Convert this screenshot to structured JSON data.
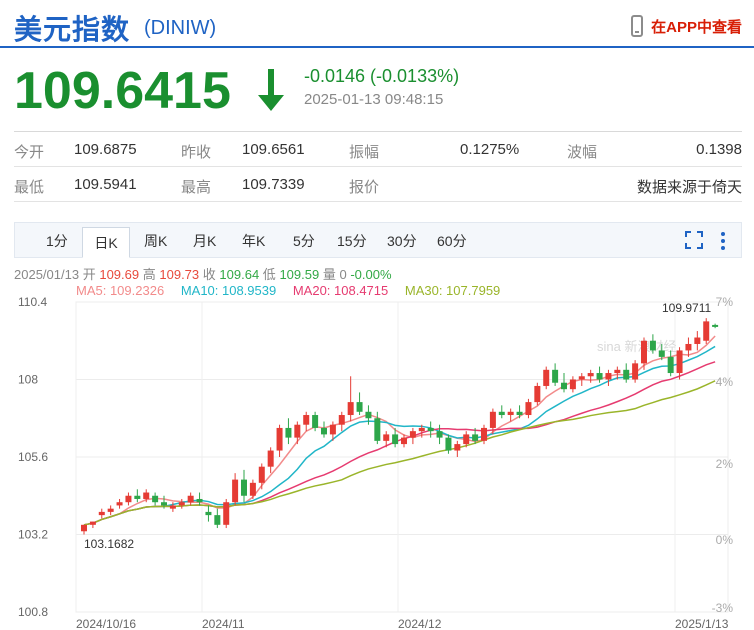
{
  "header": {
    "title": "美元指数",
    "code": "(DINIW)",
    "app_label": "在APP中查看"
  },
  "price": {
    "value": "109.6415",
    "change": "-0.0146 (-0.0133%)",
    "time": "2025-01-13 09:48:15"
  },
  "quote": {
    "row1": [
      [
        "今开",
        "109.6875"
      ],
      [
        "昨收",
        "109.6561"
      ],
      [
        "振幅",
        "0.1275%"
      ],
      [
        "波幅",
        "0.1398"
      ]
    ],
    "row2": [
      [
        "最低",
        "109.5941"
      ],
      [
        "最高",
        "109.7339"
      ],
      [
        "报价",
        ""
      ],
      [
        "",
        "数据来源于倚天"
      ]
    ]
  },
  "tabs": [
    "1分",
    "日K",
    "周K",
    "月K",
    "年K",
    "5分",
    "15分",
    "30分",
    "60分"
  ],
  "ohlc": {
    "date": "2025/01/13",
    "open_label": "开",
    "open": "109.69",
    "high_label": "高",
    "high": "109.73",
    "close_label": "收",
    "close": "109.64",
    "low_label": "低",
    "low": "109.59",
    "volume_label": "量",
    "volume": "0",
    "change": "-0.00%"
  },
  "ma": [
    {
      "label": "MA5: 109.2326",
      "color": "#f28b8b"
    },
    {
      "label": "MA10: 108.9539",
      "color": "#21b6c8"
    },
    {
      "label": "MA20: 108.4715",
      "color": "#e63b70"
    },
    {
      "label": "MA30: 107.7959",
      "color": "#9ab52a"
    }
  ],
  "chart_data": {
    "type": "candlestick",
    "x_ticks": [
      "2024/10/16",
      "2024/11",
      "2024/12",
      "2025/1/13"
    ],
    "y_ticks": [
      "110.4",
      "108",
      "105.6",
      "103.2",
      "100.8"
    ],
    "right_ticks": [
      "7%",
      "4%",
      "2%",
      "0%",
      "-3%"
    ],
    "annotations": {
      "max_label": "109.9711",
      "min_label": "103.1682"
    },
    "watermark": "sina 新浪财经",
    "candles": [
      [
        103.3,
        103.5,
        103.2,
        103.5
      ],
      [
        103.5,
        103.6,
        103.4,
        103.6
      ],
      [
        103.8,
        104.0,
        103.7,
        103.9
      ],
      [
        103.9,
        104.1,
        103.8,
        104.0
      ],
      [
        104.1,
        104.3,
        104.0,
        104.2
      ],
      [
        104.2,
        104.5,
        104.1,
        104.4
      ],
      [
        104.4,
        104.6,
        104.2,
        104.3
      ],
      [
        104.3,
        104.6,
        104.2,
        104.5
      ],
      [
        104.4,
        104.5,
        104.1,
        104.2
      ],
      [
        104.2,
        104.4,
        104.0,
        104.1
      ],
      [
        104.0,
        104.2,
        103.9,
        104.1
      ],
      [
        104.1,
        104.3,
        104.0,
        104.2
      ],
      [
        104.2,
        104.5,
        104.1,
        104.4
      ],
      [
        104.3,
        104.5,
        104.1,
        104.2
      ],
      [
        103.9,
        104.1,
        103.6,
        103.8
      ],
      [
        103.8,
        104.0,
        103.4,
        103.5
      ],
      [
        103.5,
        104.3,
        103.4,
        104.2
      ],
      [
        104.2,
        105.1,
        104.1,
        104.9
      ],
      [
        104.9,
        105.2,
        104.2,
        104.4
      ],
      [
        104.4,
        104.9,
        104.3,
        104.8
      ],
      [
        104.8,
        105.4,
        104.6,
        105.3
      ],
      [
        105.3,
        105.9,
        105.1,
        105.8
      ],
      [
        105.8,
        106.6,
        105.6,
        106.5
      ],
      [
        106.5,
        106.8,
        106.0,
        106.2
      ],
      [
        106.2,
        106.7,
        106.0,
        106.6
      ],
      [
        106.6,
        107.0,
        106.4,
        106.9
      ],
      [
        106.9,
        107.0,
        106.4,
        106.5
      ],
      [
        106.5,
        106.7,
        106.2,
        106.3
      ],
      [
        106.3,
        106.7,
        106.1,
        106.6
      ],
      [
        106.6,
        107.0,
        106.4,
        106.9
      ],
      [
        106.9,
        108.1,
        106.7,
        107.3
      ],
      [
        107.3,
        107.6,
        106.9,
        107.0
      ],
      [
        107.0,
        107.2,
        106.6,
        106.8
      ],
      [
        106.8,
        107.0,
        106.0,
        106.1
      ],
      [
        106.1,
        106.4,
        105.9,
        106.3
      ],
      [
        106.3,
        106.5,
        105.9,
        106.0
      ],
      [
        106.0,
        106.3,
        105.9,
        106.2
      ],
      [
        106.2,
        106.5,
        106.0,
        106.4
      ],
      [
        106.4,
        106.6,
        106.2,
        106.5
      ],
      [
        106.5,
        106.7,
        106.2,
        106.4
      ],
      [
        106.4,
        106.6,
        106.0,
        106.2
      ],
      [
        106.2,
        106.3,
        105.7,
        105.8
      ],
      [
        105.8,
        106.1,
        105.6,
        106.0
      ],
      [
        106.0,
        106.4,
        105.9,
        106.3
      ],
      [
        106.3,
        106.5,
        106.0,
        106.1
      ],
      [
        106.1,
        106.6,
        106.0,
        106.5
      ],
      [
        106.5,
        107.1,
        106.3,
        107.0
      ],
      [
        107.0,
        107.2,
        106.8,
        106.9
      ],
      [
        106.9,
        107.1,
        106.7,
        107.0
      ],
      [
        107.0,
        107.2,
        106.8,
        106.9
      ],
      [
        106.9,
        107.4,
        106.8,
        107.3
      ],
      [
        107.3,
        107.9,
        107.2,
        107.8
      ],
      [
        107.8,
        108.4,
        107.7,
        108.3
      ],
      [
        108.3,
        108.5,
        107.8,
        107.9
      ],
      [
        107.9,
        108.2,
        107.6,
        107.7
      ],
      [
        107.7,
        108.1,
        107.6,
        108.0
      ],
      [
        108.0,
        108.2,
        107.8,
        108.1
      ],
      [
        108.1,
        108.3,
        107.9,
        108.2
      ],
      [
        108.2,
        108.4,
        107.9,
        108.0
      ],
      [
        108.0,
        108.3,
        107.8,
        108.2
      ],
      [
        108.2,
        108.4,
        108.0,
        108.3
      ],
      [
        108.3,
        108.5,
        107.9,
        108.0
      ],
      [
        108.0,
        108.6,
        107.9,
        108.5
      ],
      [
        108.5,
        109.3,
        108.3,
        109.2
      ],
      [
        109.2,
        109.4,
        108.8,
        108.9
      ],
      [
        108.9,
        109.1,
        108.6,
        108.7
      ],
      [
        108.7,
        108.9,
        108.1,
        108.2
      ],
      [
        108.2,
        109.0,
        108.0,
        108.9
      ],
      [
        108.9,
        109.3,
        108.7,
        109.1
      ],
      [
        109.1,
        109.5,
        108.9,
        109.3
      ],
      [
        109.2,
        109.9,
        109.1,
        109.8
      ],
      [
        109.69,
        109.73,
        109.59,
        109.64
      ]
    ]
  }
}
